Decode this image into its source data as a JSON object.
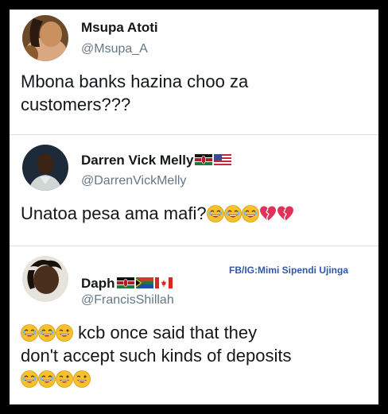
{
  "tweets": [
    {
      "name": "Msupa Atoti",
      "handle": "@Msupa_A",
      "text_line1": "Mbona banks hazina choo za",
      "text_line2": "customers???"
    },
    {
      "name": "Darren Vick Melly",
      "handle": "@DarrenVickMelly",
      "text": "Unatoa pesa ama mafi?",
      "flags": [
        "kenya-flag",
        "usa-flag"
      ],
      "emojis": [
        "laughing-emoji",
        "laughing-emoji",
        "laughing-emoji",
        "broken-heart-emoji",
        "broken-heart-emoji"
      ]
    },
    {
      "name": "Daph",
      "handle": "@FrancisShillah",
      "text_line1": "kcb once said that they",
      "text_line2": "don't accept such kinds of deposits",
      "flags": [
        "kenya-flag",
        "south-africa-flag",
        "canada-flag"
      ],
      "emojis_line1": [
        "laughing-emoji",
        "laughing-emoji",
        "winking-laughing-emoji"
      ],
      "emojis_line3": [
        "laughing-emoji",
        "laughing-emoji",
        "winking-laughing-emoji",
        "winking-laughing-emoji"
      ]
    }
  ],
  "watermark": "FB/IG:Mimi Sipendi Ujinga",
  "colors": {
    "background": "#000000",
    "card": "#ffffff",
    "name": "#14171a",
    "handle": "#657786",
    "watermark": "#2f57a8"
  }
}
